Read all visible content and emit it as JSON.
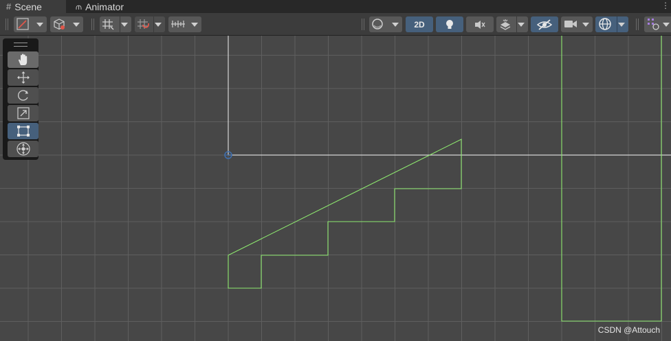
{
  "tabs": [
    {
      "label": "Scene",
      "icon": "grid-hash-icon",
      "active": true
    },
    {
      "label": "Animator",
      "icon": "animator-icon",
      "active": false
    }
  ],
  "toolbar": {
    "mode_2d_label": "2D"
  },
  "tools": [
    {
      "name": "hand-tool",
      "icon": "hand-icon"
    },
    {
      "name": "move-tool",
      "icon": "move-arrows-icon"
    },
    {
      "name": "rotate-tool",
      "icon": "rotate-icon"
    },
    {
      "name": "scale-tool",
      "icon": "scale-icon"
    },
    {
      "name": "rect-tool",
      "icon": "rect-transform-icon",
      "selected": true
    },
    {
      "name": "transform-tool",
      "icon": "transform-icon"
    }
  ],
  "colors": {
    "scene_bg": "#474747",
    "grid": "#5f5f5f",
    "axis": "#d6d6d6",
    "collider": "#8ee86f",
    "active_toggle": "#46607c"
  },
  "watermark": "CSDN @Attouch"
}
